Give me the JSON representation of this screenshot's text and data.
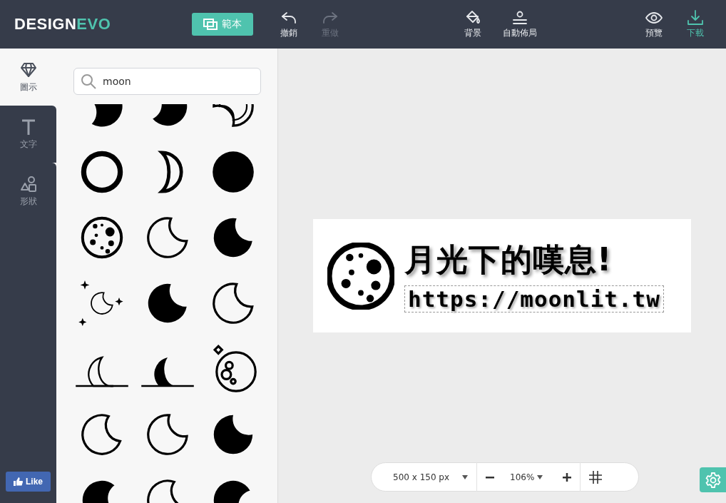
{
  "logo": {
    "main": "DESIGN",
    "accent": "EVO"
  },
  "toolbar": {
    "template_button": "範本",
    "history": [
      {
        "label": "撤銷",
        "kind": "undo",
        "disabled": false,
        "accent": false
      },
      {
        "label": "重做",
        "kind": "redo",
        "disabled": true,
        "accent": false
      }
    ],
    "layout": [
      {
        "label": "背景",
        "kind": "bucket",
        "disabled": false,
        "accent": false
      },
      {
        "label": "自動佈局",
        "kind": "align",
        "disabled": false,
        "accent": false
      }
    ],
    "output": [
      {
        "label": "預覽",
        "kind": "eye",
        "disabled": false,
        "accent": false
      },
      {
        "label": "下載",
        "kind": "download",
        "disabled": false,
        "accent": true
      }
    ]
  },
  "rail": [
    {
      "label": "圖示",
      "kind": "diamond",
      "selected": true
    },
    {
      "label": "文字",
      "kind": "text",
      "selected": false
    },
    {
      "label": "形狀",
      "kind": "shapes",
      "selected": false
    }
  ],
  "like_button": "Like",
  "search": {
    "value": "moon"
  },
  "canvas": {
    "title": "月光下的嘆息!",
    "url": "https://moonlit.tw",
    "url_selected": true
  },
  "zoom_bar": {
    "size": "500 x 150 px",
    "zoom": "106%"
  }
}
